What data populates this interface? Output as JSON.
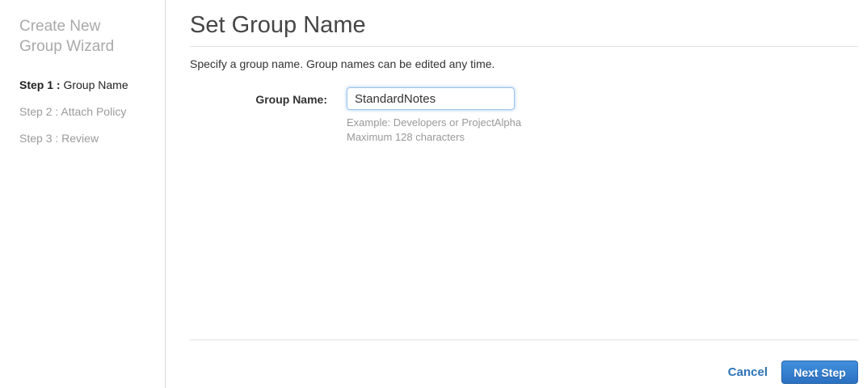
{
  "sidebar": {
    "title": "Create New Group Wizard",
    "steps": [
      {
        "prefix": "Step 1 :",
        "label": "Group Name",
        "active": true
      },
      {
        "prefix": "Step 2 :",
        "label": "Attach Policy",
        "active": false
      },
      {
        "prefix": "Step 3 :",
        "label": "Review",
        "active": false
      }
    ]
  },
  "main": {
    "title": "Set Group Name",
    "description": "Specify a group name. Group names can be edited any time.",
    "form": {
      "label": "Group Name:",
      "value": "StandardNotes",
      "hint_example": "Example: Developers or ProjectAlpha",
      "hint_max": "Maximum 128 characters"
    },
    "footer": {
      "cancel_label": "Cancel",
      "next_label": "Next Step"
    }
  },
  "colors": {
    "accent_blue": "#2e73b8",
    "button_gradient_top": "#4190de",
    "button_gradient_bottom": "#2b70c1",
    "input_focus_border": "#9cc5ec",
    "inactive_gray": "#9b9b9b",
    "divider_gray": "#e2e2e2"
  }
}
